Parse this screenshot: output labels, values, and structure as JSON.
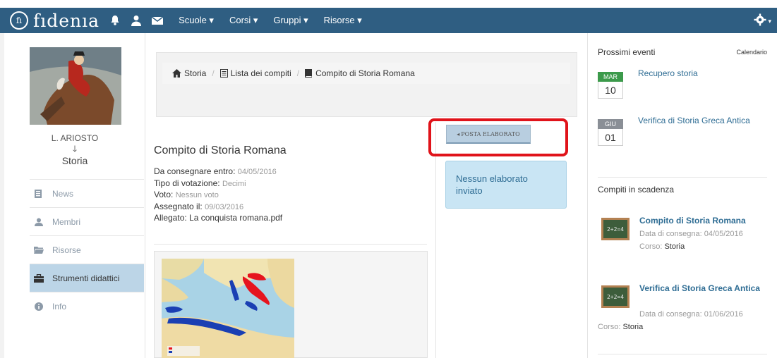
{
  "navbar": {
    "logo_mark": "fı",
    "logo_text": "fıdenıa",
    "menu": [
      "Scuole ▾",
      "Corsi ▾",
      "Gruppi ▾",
      "Risorse ▾"
    ],
    "bg_color": "#2f5e82"
  },
  "profile": {
    "name": "L. ARIOSTO",
    "arrow": "🡓",
    "course": "Storia"
  },
  "sidebar": {
    "items": [
      {
        "label": "News",
        "icon": "news-icon"
      },
      {
        "label": "Membri",
        "icon": "user-icon"
      },
      {
        "label": "Risorse",
        "icon": "folder-icon"
      },
      {
        "label": "Strumenti didattici",
        "icon": "briefcase-icon",
        "active": true
      },
      {
        "label": "Info",
        "icon": "info-icon"
      }
    ]
  },
  "breadcrumb": {
    "items": [
      "Storia",
      "Lista dei compiti",
      "Compito di Storia Romana"
    ]
  },
  "assignment": {
    "title": "Compito di Storia Romana",
    "due_label": "Da consegnare entro:",
    "due_value": "04/05/2016",
    "grading_label": "Tipo di votazione:",
    "grading_value": "Decimi",
    "grade_label": "Voto:",
    "grade_value": "Nessun voto",
    "assigned_label": "Assegnato il:",
    "assigned_value": "09/03/2016",
    "attachment_label": "Allegato:",
    "attachment_value": "La conquista romana.pdf"
  },
  "post_button": {
    "label": "POSTA ELABORATO"
  },
  "alert": {
    "text": "Nessun elaborato inviato"
  },
  "events": {
    "header": "Prossimi eventi",
    "calendar_link": "Calendario",
    "items": [
      {
        "month": "MAR",
        "day": "10",
        "title": "Recupero storia",
        "color": "#3c9a4b"
      },
      {
        "month": "GIU",
        "day": "01",
        "title": "Verifica di Storia Greca Antica",
        "color": "#8a8f96"
      }
    ]
  },
  "due_tasks": {
    "header": "Compiti in scadenza",
    "items": [
      {
        "title": "Compito di Storia Romana",
        "date_label": "Data di consegna: 04/05/2016",
        "course_label": "Corso:",
        "course": "Storia",
        "chalk": "2+2=4"
      },
      {
        "title": "Verifica di Storia Greca Antica",
        "date_label": "Data di consegna: 01/06/2016",
        "course_label": "Corso:",
        "course": "Storia",
        "chalk": "2+2=4"
      }
    ]
  }
}
